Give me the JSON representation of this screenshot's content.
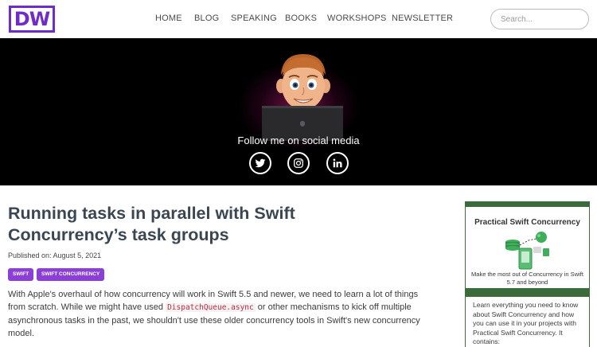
{
  "header": {
    "logo": "DW",
    "nav": [
      "HOME",
      "BLOG",
      "SPEAKING",
      "BOOKS",
      "WORKSHOPS",
      "NEWSLETTER"
    ],
    "search_placeholder": "Search..."
  },
  "hero": {
    "social_title": "Follow me on social media",
    "social_icons": [
      "twitter-icon",
      "instagram-icon",
      "linkedin-icon"
    ]
  },
  "article": {
    "title": "Running tasks in parallel with Swift Concurrency’s task groups",
    "published": "Published on: August 5, 2021",
    "tags": [
      "SWIFT",
      "SWIFT CONCURRENCY"
    ],
    "intro_before_code": "With Apple's overhaul of how concurrency will work in Swift 5.5 and newer, we need to learn a lot of things from scratch. While we might have used ",
    "intro_code": "DispatchQueue.async",
    "intro_after_code": " or other mechanisms to kick off multiple asynchronous tasks in the past, we shouldn't use these older concurrency tools in Swift's new concurrency model."
  },
  "sidebar": {
    "card_title": "Practical Swift Concurrency",
    "card_subtitle": "Make the most out of Concurrency in Swift 5.7 and beyond",
    "card_text": "Learn everything you need to know about Swift Concurrency and how you can use it in your projects with Practical Swift Concurrency. It contains:"
  },
  "colors": {
    "brand_purple": "#6f2cc9",
    "tag_purple": "#8b3fd6",
    "card_green": "#3c6b3b",
    "code_red": "#c9283c"
  }
}
